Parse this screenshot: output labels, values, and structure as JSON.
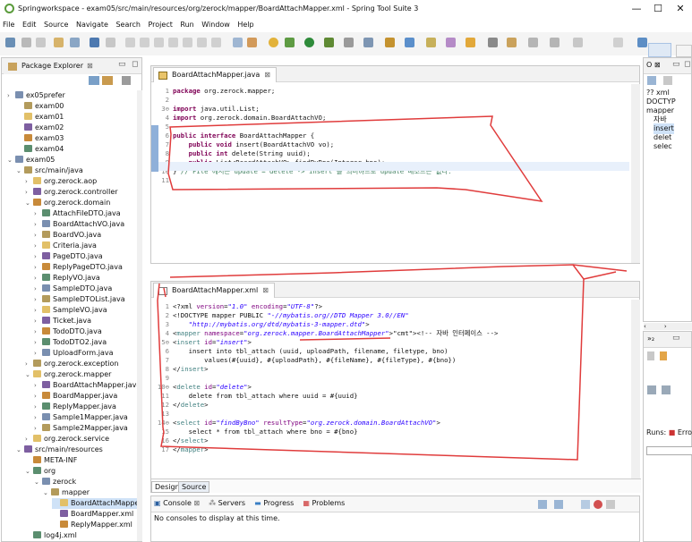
{
  "window": {
    "title": "Springworkspace - exam05/src/main/resources/org/zerock/mapper/BoardAttachMapper.xml - Spring Tool Suite 3",
    "minimize": "—",
    "maximize": "☐",
    "close": "✕"
  },
  "menu": [
    "File",
    "Edit",
    "Source",
    "Navigate",
    "Search",
    "Project",
    "Run",
    "Window",
    "Help"
  ],
  "package_explorer": {
    "tab_label": "Package Explorer",
    "items": [
      {
        "indent": 0,
        "arrow": "›",
        "label": "ex05prefer"
      },
      {
        "indent": 1,
        "arrow": "",
        "label": "exam00"
      },
      {
        "indent": 1,
        "arrow": "",
        "label": "exam01"
      },
      {
        "indent": 1,
        "arrow": "",
        "label": "exam02"
      },
      {
        "indent": 1,
        "arrow": "",
        "label": "exam03"
      },
      {
        "indent": 1,
        "arrow": "",
        "label": "exam04"
      },
      {
        "indent": 0,
        "arrow": "⌄",
        "label": "exam05"
      },
      {
        "indent": 1,
        "arrow": "⌄",
        "label": "src/main/java"
      },
      {
        "indent": 2,
        "arrow": "›",
        "label": "org.zerock.aop"
      },
      {
        "indent": 2,
        "arrow": "›",
        "label": "org.zerock.controller"
      },
      {
        "indent": 2,
        "arrow": "⌄",
        "label": "org.zerock.domain"
      },
      {
        "indent": 3,
        "arrow": "›",
        "label": "AttachFileDTO.java"
      },
      {
        "indent": 3,
        "arrow": "›",
        "label": "BoardAttachVO.java"
      },
      {
        "indent": 3,
        "arrow": "›",
        "label": "BoardVO.java"
      },
      {
        "indent": 3,
        "arrow": "›",
        "label": "Criteria.java"
      },
      {
        "indent": 3,
        "arrow": "›",
        "label": "PageDTO.java"
      },
      {
        "indent": 3,
        "arrow": "›",
        "label": "ReplyPageDTO.java"
      },
      {
        "indent": 3,
        "arrow": "›",
        "label": "ReplyVO.java"
      },
      {
        "indent": 3,
        "arrow": "›",
        "label": "SampleDTO.java"
      },
      {
        "indent": 3,
        "arrow": "›",
        "label": "SampleDTOList.java"
      },
      {
        "indent": 3,
        "arrow": "›",
        "label": "SampleVO.java"
      },
      {
        "indent": 3,
        "arrow": "›",
        "label": "Ticket.java"
      },
      {
        "indent": 3,
        "arrow": "›",
        "label": "TodoDTO.java"
      },
      {
        "indent": 3,
        "arrow": "›",
        "label": "TodoDTO2.java"
      },
      {
        "indent": 3,
        "arrow": "›",
        "label": "UploadForm.java"
      },
      {
        "indent": 2,
        "arrow": "›",
        "label": "org.zerock.exception"
      },
      {
        "indent": 2,
        "arrow": "⌄",
        "label": "org.zerock.mapper"
      },
      {
        "indent": 3,
        "arrow": "›",
        "label": "BoardAttachMapper.java"
      },
      {
        "indent": 3,
        "arrow": "›",
        "label": "BoardMapper.java"
      },
      {
        "indent": 3,
        "arrow": "›",
        "label": "ReplyMapper.java"
      },
      {
        "indent": 3,
        "arrow": "›",
        "label": "Sample1Mapper.java"
      },
      {
        "indent": 3,
        "arrow": "›",
        "label": "Sample2Mapper.java"
      },
      {
        "indent": 2,
        "arrow": "›",
        "label": "org.zerock.service"
      },
      {
        "indent": 1,
        "arrow": "⌄",
        "label": "src/main/resources"
      },
      {
        "indent": 2,
        "arrow": "",
        "label": "META-INF"
      },
      {
        "indent": 2,
        "arrow": "⌄",
        "label": "org"
      },
      {
        "indent": 3,
        "arrow": "⌄",
        "label": "zerock"
      },
      {
        "indent": 4,
        "arrow": "⌄",
        "label": "mapper"
      },
      {
        "indent": 5,
        "arrow": "",
        "label": "BoardAttachMappe"
      },
      {
        "indent": 5,
        "arrow": "",
        "label": "BoardMapper.xml"
      },
      {
        "indent": 5,
        "arrow": "",
        "label": "ReplyMapper.xml"
      },
      {
        "indent": 2,
        "arrow": "",
        "label": "log4j.xml"
      },
      {
        "indent": 2,
        "arrow": "",
        "label": "log4jdbc.log4j2.properties"
      }
    ]
  },
  "java_editor": {
    "tab_label": "BoardAttachMapper.java",
    "line_numbers": [
      "1",
      "2",
      "3⊖",
      "4",
      "5",
      "6",
      "7",
      "8",
      "9",
      "10",
      "11"
    ],
    "lines": [
      "package org.zerock.mapper;",
      "",
      "import java.util.List;",
      "import org.zerock.domain.BoardAttachVO;",
      "",
      "public interface BoardAttachMapper {",
      "    public void insert(BoardAttachVO vo);",
      "    public int delete(String uuid);",
      "    public List<BoardAttachVO> findByBno(Integer bno);",
      "} // File 에서는 update = delete -> insert 를 의미하므로 update 메소드는 없다.",
      ""
    ]
  },
  "xml_editor": {
    "tab_label": "BoardAttachMapper.xml",
    "line_numbers": [
      "1",
      "2",
      "3",
      "4",
      "5⊖",
      "6",
      "7",
      "8",
      "9",
      "10⊖",
      "11",
      "12",
      "13",
      "14⊖",
      "15",
      "16",
      "17"
    ],
    "lines": [
      "<?xml version=\"1.0\" encoding=\"UTF-8\"?>",
      "<!DOCTYPE mapper PUBLIC \"-//mybatis.org//DTD Mapper 3.0//EN\"",
      "    \"http://mybatis.org/dtd/mybatis-3-mapper.dtd\">",
      "<mapper namespace=\"org.zerock.mapper.BoardAttachMapper\"><!-- 자바 인터페이스 -->",
      "<insert id=\"insert\">",
      "    insert into tbl_attach (uuid, uploadPath, filename, filetype, bno)",
      "        values(#{uuid}, #{uploadPath}, #{fileName}, #{fileType}, #{bno})",
      "</insert>",
      "",
      "<delete id=\"delete\">",
      "    delete from tbl_attach where uuid = #{uuid}",
      "</delete>",
      "",
      "<select id=\"findByBno\" resultType=\"org.zerock.domain.BoardAttachVO\">",
      "    select * from tbl_attach where bno = #{bno}",
      "</select>",
      "</mapper>"
    ],
    "bottom_tabs": [
      "Design",
      "Source"
    ]
  },
  "console": {
    "tabs": [
      "Console",
      "Servers",
      "Progress",
      "Problems"
    ],
    "message": "No consoles to display at this time."
  },
  "outline": {
    "items": [
      "?? xml",
      "DOCTYP",
      "mapper",
      "자바",
      "insert",
      "delet",
      "selec"
    ]
  },
  "junit": {
    "runs_label": "Runs:",
    "errors_label": "Erro"
  },
  "colors": {
    "accent": "#3a7fc4",
    "annotation_red": "#e03c3c",
    "selection": "#cfe2f7"
  }
}
